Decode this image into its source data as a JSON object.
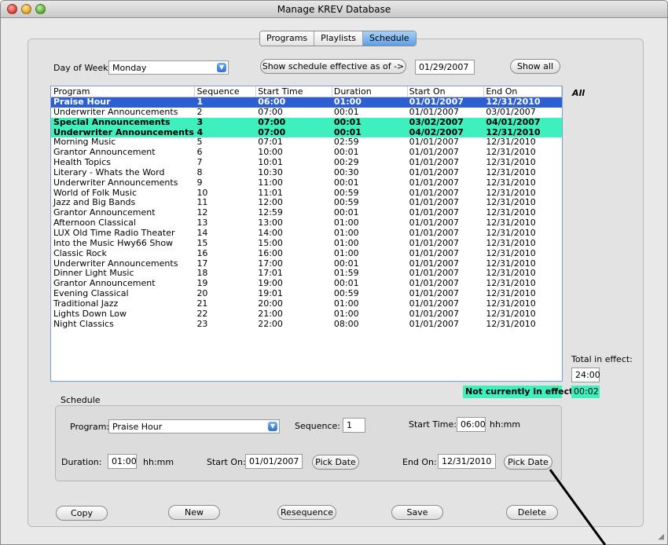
{
  "window": {
    "title": "Manage KREV Database"
  },
  "tabs": [
    {
      "label": "Programs",
      "active": false
    },
    {
      "label": "Playlists",
      "active": false
    },
    {
      "label": "Schedule",
      "active": true
    }
  ],
  "filter": {
    "day_label": "Day of Week:",
    "day_value": "Monday",
    "effective_button": "Show schedule effective as of ->",
    "effective_date": "01/29/2007",
    "show_all_button": "Show all",
    "all_label": "All"
  },
  "table": {
    "columns": [
      "Program",
      "Sequence",
      "Start Time",
      "Duration",
      "Start On",
      "End On"
    ],
    "rows": [
      [
        "Praise Hour",
        "1",
        "06:00",
        "01:00",
        "01/01/2007",
        "12/31/2010"
      ],
      [
        "Underwriter Announcements",
        "2",
        "07:00",
        "00:01",
        "01/01/2007",
        "03/01/2007"
      ],
      [
        "Special Announcements",
        "3",
        "07:00",
        "00:01",
        "03/02/2007",
        "04/01/2007"
      ],
      [
        "Underwriter Announcements",
        "4",
        "07:00",
        "00:01",
        "04/02/2007",
        "12/31/2010"
      ],
      [
        "Morning Music",
        "5",
        "07:01",
        "02:59",
        "01/01/2007",
        "12/31/2010"
      ],
      [
        "Grantor Announcement",
        "6",
        "10:00",
        "00:01",
        "01/01/2007",
        "12/31/2010"
      ],
      [
        "Health Topics",
        "7",
        "10:01",
        "00:29",
        "01/01/2007",
        "12/31/2010"
      ],
      [
        "Literary - Whats the Word",
        "8",
        "10:30",
        "00:30",
        "01/01/2007",
        "12/31/2010"
      ],
      [
        "Underwriter Announcements",
        "9",
        "11:00",
        "00:01",
        "01/01/2007",
        "12/31/2010"
      ],
      [
        "World of Folk Music",
        "10",
        "11:01",
        "00:59",
        "01/01/2007",
        "12/31/2010"
      ],
      [
        "Jazz and Big Bands",
        "11",
        "12:00",
        "00:59",
        "01/01/2007",
        "12/31/2010"
      ],
      [
        "Grantor Announcement",
        "12",
        "12:59",
        "00:01",
        "01/01/2007",
        "12/31/2010"
      ],
      [
        "Afternoon Classical",
        "13",
        "13:00",
        "01:00",
        "01/01/2007",
        "12/31/2010"
      ],
      [
        "LUX Old Time Radio Theater",
        "14",
        "14:00",
        "01:00",
        "01/01/2007",
        "12/31/2010"
      ],
      [
        "Into the Music Hwy66 Show",
        "15",
        "15:00",
        "01:00",
        "01/01/2007",
        "12/31/2010"
      ],
      [
        "Classic Rock",
        "16",
        "16:00",
        "01:00",
        "01/01/2007",
        "12/31/2010"
      ],
      [
        "Underwriter Announcements",
        "17",
        "17:00",
        "00:01",
        "01/01/2007",
        "12/31/2010"
      ],
      [
        "Dinner Light Music",
        "18",
        "17:01",
        "01:59",
        "01/01/2007",
        "12/31/2010"
      ],
      [
        "Grantor Announcement",
        "19",
        "19:00",
        "00:01",
        "01/01/2007",
        "12/31/2010"
      ],
      [
        "Evening Classical",
        "20",
        "19:01",
        "00:59",
        "01/01/2007",
        "12/31/2010"
      ],
      [
        "Traditional Jazz",
        "21",
        "20:00",
        "01:00",
        "01/01/2007",
        "12/31/2010"
      ],
      [
        "Lights Down Low",
        "22",
        "21:00",
        "01:00",
        "01/01/2007",
        "12/31/2010"
      ],
      [
        "Night Classics",
        "23",
        "22:00",
        "08:00",
        "01/01/2007",
        "12/31/2010"
      ]
    ],
    "selected_row": 0,
    "pending_rows": [
      2,
      3
    ]
  },
  "totals": {
    "total_label": "Total in effect:",
    "total_value": "24:00",
    "not_in_effect_label": "Not currently in effect:",
    "not_in_effect_value": "00:02"
  },
  "schedule": {
    "group_label": "Schedule",
    "program_label": "Program:",
    "program_value": "Praise Hour",
    "sequence_label": "Sequence:",
    "sequence_value": "1",
    "start_time_label": "Start Time:",
    "start_time_value": "06:00",
    "start_time_unit": "hh:mm",
    "duration_label": "Duration:",
    "duration_value": "01:00",
    "duration_unit": "hh:mm",
    "start_on_label": "Start On:",
    "start_on_value": "01/01/2007",
    "start_pick_button": "Pick Date",
    "end_on_label": "End On:",
    "end_on_value": "12/31/2010",
    "end_pick_button": "Pick Date"
  },
  "actions": {
    "copy": "Copy",
    "new": "New",
    "resequence": "Resequence",
    "save": "Save",
    "delete": "Delete"
  },
  "colors": {
    "selection": "#2d5fd2",
    "pending_highlight": "#3ef0bd",
    "tab_active": "#5c9ee6"
  }
}
